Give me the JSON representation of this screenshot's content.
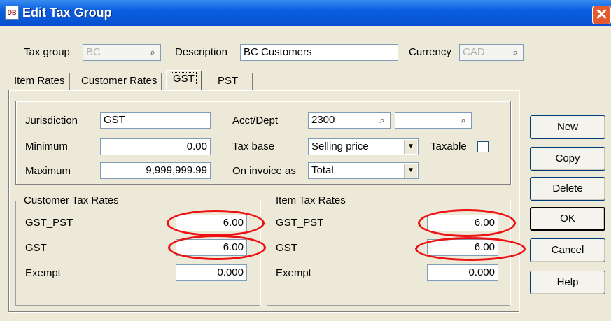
{
  "window": {
    "title": "Edit Tax Group",
    "icon": "app-icon",
    "close_icon": "✕"
  },
  "header": {
    "tax_group_label": "Tax group",
    "tax_group_value": "BC",
    "description_label": "Description",
    "description_value": "BC Customers",
    "currency_label": "Currency",
    "currency_value": "CAD",
    "lookup_icon": "🔍"
  },
  "tabs": [
    {
      "label": "Item Rates"
    },
    {
      "label": "Customer Rates"
    },
    {
      "label": "GST"
    },
    {
      "label": "PST"
    }
  ],
  "active_tab": "GST",
  "form": {
    "jurisdiction_label": "Jurisdiction",
    "jurisdiction_value": "GST",
    "minimum_label": "Minimum",
    "minimum_value": "0.00",
    "maximum_label": "Maximum",
    "maximum_value": "9,999,999.99",
    "acct_label": "Acct/Dept",
    "acct_value": "2300",
    "dept_value": "",
    "taxbase_label": "Tax base",
    "taxbase_value": "Selling price",
    "taxable_label": "Taxable",
    "taxable_checked": false,
    "oninvoice_label": "On invoice as",
    "oninvoice_value": "Total"
  },
  "customer_rates": {
    "title": "Customer Tax Rates",
    "rows": [
      {
        "label": "GST_PST",
        "value": "6.00"
      },
      {
        "label": "GST",
        "value": "6.00"
      },
      {
        "label": "Exempt",
        "value": "0.000"
      }
    ]
  },
  "item_rates": {
    "title": "Item Tax Rates",
    "rows": [
      {
        "label": "GST_PST",
        "value": "6.00"
      },
      {
        "label": "GST",
        "value": "6.00"
      },
      {
        "label": "Exempt",
        "value": "0.000"
      }
    ]
  },
  "buttons": {
    "new": "New",
    "copy": "Copy",
    "delete": "Delete",
    "ok": "OK",
    "cancel": "Cancel",
    "help": "Help"
  },
  "colors": {
    "title_bar": "#0a5fe0",
    "annotation": "#ee1111",
    "dialog_bg": "#ece9d8"
  }
}
